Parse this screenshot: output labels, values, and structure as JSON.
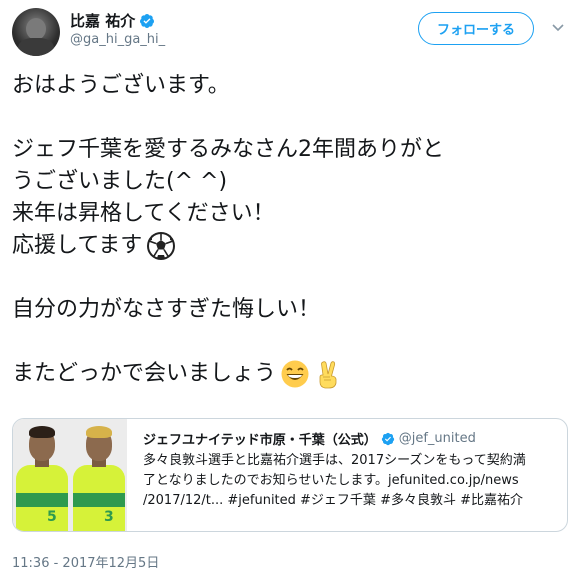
{
  "author": {
    "display_name": "比嘉 祐介",
    "handle": "@ga_hi_ga_hi_",
    "verified": true
  },
  "follow_button_label": "フォローする",
  "tweet": {
    "lines": [
      "おはようございます。",
      "",
      "ジェフ千葉を愛するみなさん2年間ありがと",
      "うございました(^ ^)",
      "来年は昇格してください！",
      "応援してます",
      "",
      "自分の力がなさすぎた悔しい！",
      "",
      "またどっかで会いましょう"
    ],
    "emoji_soccer": "soccer-ball-icon",
    "emoji_grin": "grinning-face-icon",
    "emoji_victory": "victory-hand-icon"
  },
  "quote": {
    "display_name": "ジェフユナイテッド市原・千葉（公式）",
    "handle": "@jef_united",
    "verified": true,
    "body_lines": [
      "多々良敦斗選手と比嘉祐介選手は、2017シーズンをもって契約満",
      "了となりましたのでお知らせいたします。jefunited.co.jp/news",
      "/2017/12/t... #jefunited #ジェフ千葉 #多々良敦斗 #比嘉祐介"
    ],
    "player_numbers": [
      "5",
      "3"
    ]
  },
  "timestamp": "11:36 - 2017年12月5日",
  "colors": {
    "accent": "#1da1f2",
    "text": "#14171a",
    "secondary": "#657786",
    "jersey_yellow": "#d6f239",
    "jersey_green": "#2e9a4e"
  }
}
